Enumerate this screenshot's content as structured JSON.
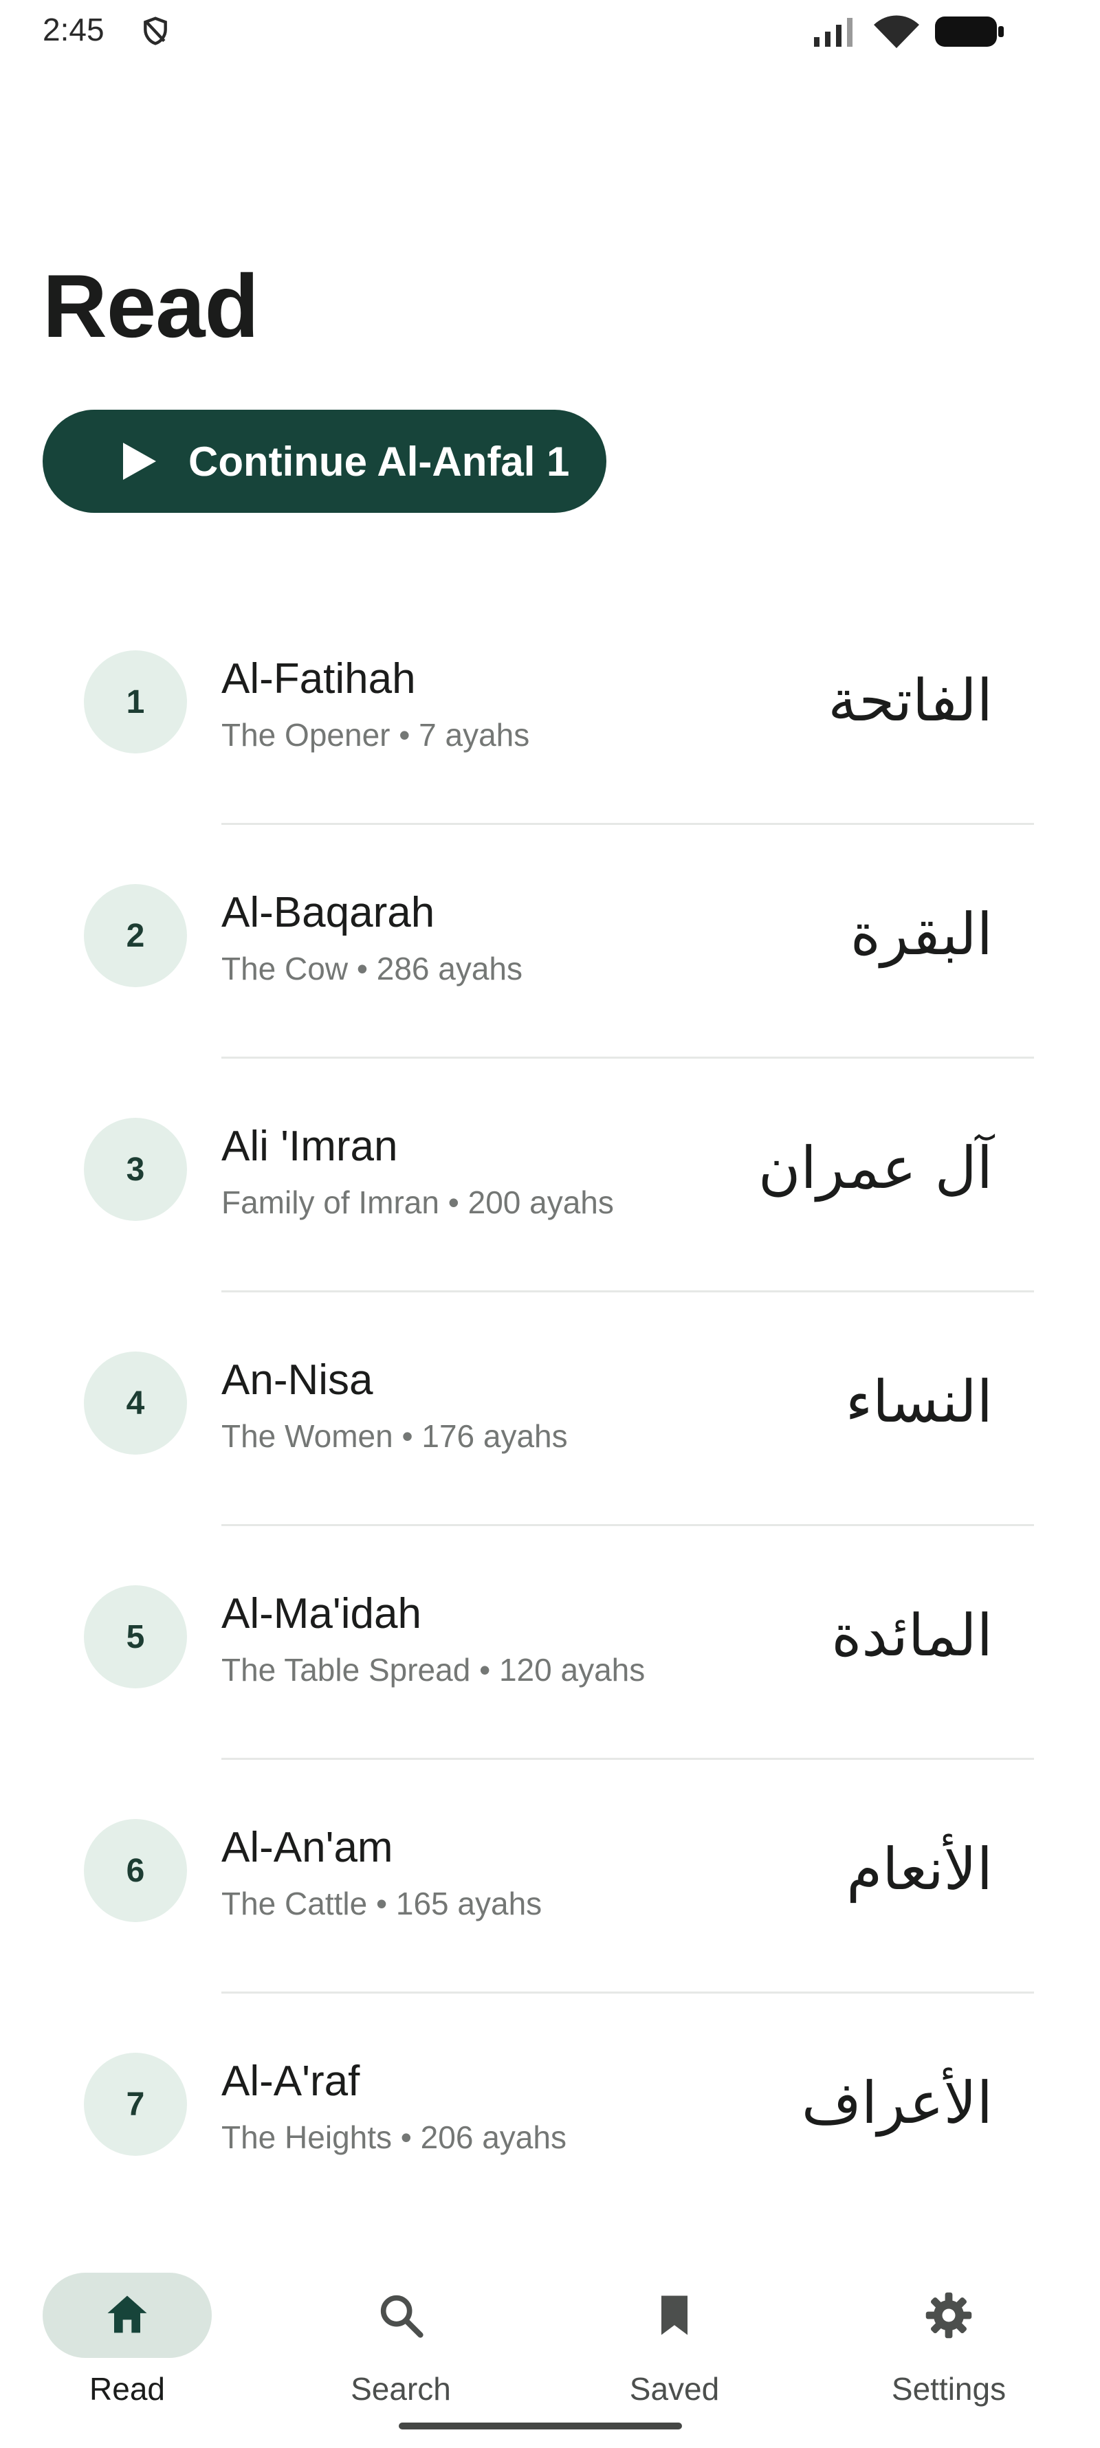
{
  "status_bar": {
    "time": "2:45",
    "icons": [
      "shield-icon",
      "signal-icon",
      "wifi-icon",
      "battery-icon"
    ]
  },
  "header": {
    "title": "Read"
  },
  "continue_button": {
    "label": "Continue Al-Anfal 1",
    "icon": "play-icon"
  },
  "surahs": [
    {
      "number": "1",
      "name": "Al-Fatihah",
      "meta": "The Opener • 7 ayahs",
      "arabic": "الفاتحة"
    },
    {
      "number": "2",
      "name": "Al-Baqarah",
      "meta": "The Cow • 286 ayahs",
      "arabic": "البقرة"
    },
    {
      "number": "3",
      "name": "Ali 'Imran",
      "meta": "Family of Imran • 200 ayahs",
      "arabic": "آل عمران"
    },
    {
      "number": "4",
      "name": "An-Nisa",
      "meta": "The Women • 176 ayahs",
      "arabic": "النساء"
    },
    {
      "number": "5",
      "name": "Al-Ma'idah",
      "meta": "The Table Spread • 120 ayahs",
      "arabic": "المائدة"
    },
    {
      "number": "6",
      "name": "Al-An'am",
      "meta": "The Cattle • 165 ayahs",
      "arabic": "الأنعام"
    },
    {
      "number": "7",
      "name": "Al-A'raf",
      "meta": "The Heights • 206 ayahs",
      "arabic": "الأعراف"
    }
  ],
  "bottom_nav": {
    "items": [
      {
        "label": "Read",
        "icon": "home-icon",
        "active": true
      },
      {
        "label": "Search",
        "icon": "search-icon",
        "active": false
      },
      {
        "label": "Saved",
        "icon": "bookmark-icon",
        "active": false
      },
      {
        "label": "Settings",
        "icon": "gear-icon",
        "active": false
      }
    ]
  },
  "colors": {
    "primary": "#17443a",
    "number_badge_bg": "#e4efe9",
    "nav_active_pill": "#dae5df",
    "secondary_text": "#747775",
    "divider": "#e6e8e6"
  }
}
